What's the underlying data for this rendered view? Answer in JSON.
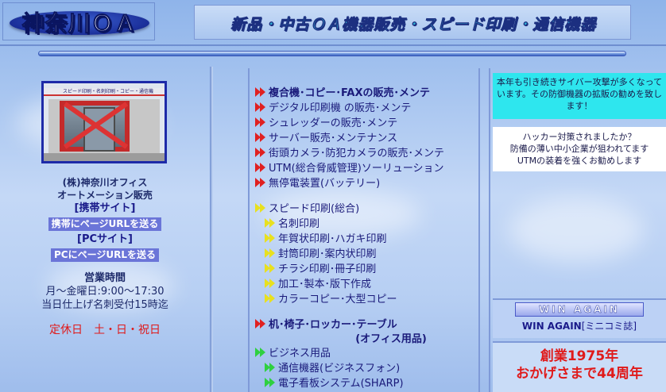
{
  "header": {
    "logo": "神奈川ＯＡ",
    "banner": "新品・中古ＯＡ機器販売・スピード印刷・通信機器"
  },
  "left": {
    "storefront_sign": "スピード印刷・名刺印刷・コピー・通信機",
    "company_line1": "(株)神奈川オフィス",
    "company_line2": "オートメーション販売",
    "mobile_heading": "[携帯サイト]",
    "mobile_button": "携帯にページURLを送る",
    "pc_heading": "[PCサイト]",
    "pc_button": "PCにページURLを送る",
    "hours_title": "営業時間",
    "hours_line1": "月～金曜日:9:00～17:30",
    "hours_line2": "当日仕上げ名刺受付15時迄",
    "closed": "定休日　土・日・祝日"
  },
  "middle": {
    "items": [
      {
        "text": "複合機･コピー･FAXの販売･メンテ",
        "style": "red",
        "bold": true
      },
      {
        "text": "デジタル印刷機 の販売･メンテ",
        "style": "red"
      },
      {
        "text": "シュレッダーの販売･メンテ",
        "style": "red"
      },
      {
        "text": "サーバー販売･メンテナンス",
        "style": "red"
      },
      {
        "text": "街頭カメラ･防犯カメラの販売･メンテ",
        "style": "red"
      },
      {
        "text": "UTM(総合脅威管理)ソーリューション",
        "style": "red"
      },
      {
        "text": "無停電装置(バッテリー)",
        "style": "red"
      }
    ],
    "print_heading": "スピード印刷",
    "print_heading_note": "(総合)",
    "print_items": [
      "名刺印刷",
      "年賀状印刷･ハガキ印刷",
      "封筒印刷･案内状印刷",
      "チラシ印刷･冊子印刷",
      "加工･製本･版下作成",
      "カラーコピー･大型コピー"
    ],
    "furniture_heading": "机･椅子･ロッカー･テーブル",
    "furniture_note": "(オフィス用品)",
    "business_heading": "ビジネス用品",
    "business_items": [
      "通信機器(ビジネスフォン)",
      "電子看板システム(SHARP)"
    ]
  },
  "right": {
    "cyber_notice": "本年も引き続きサイバー攻撃が多くなっています。その防御機器の拡販の勧めを致します！",
    "hacker_line1": "ハッカー対策されましたか？",
    "hacker_line2": "防備の薄い中小企業が狙われてます",
    "hacker_line3": "UTMの装着を強くお勧めします",
    "win_logo": "WIN AGAIN",
    "win_caption": "WIN AGAIN",
    "win_caption_note": "[ミニコミ誌]",
    "anniv_line1": "創業1975年",
    "anniv_line2": "おかげさまで44周年"
  },
  "colors": {
    "accent_red": "#e01a1a",
    "cyan_box": "#2ee6ee",
    "link_button": "#6b75d8"
  }
}
